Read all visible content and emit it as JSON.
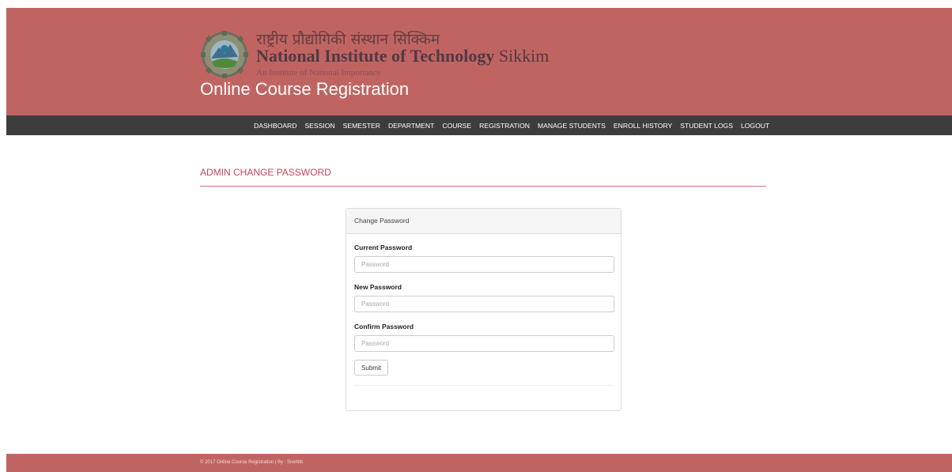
{
  "header": {
    "hindi_name": "राष्ट्रीय प्रौद्योगिकी संस्थान सिक्किम",
    "institute_name_main": "National Institute of Technology",
    "institute_name_place": "Sikkim",
    "tagline": "An Institute of National Importance",
    "app_title": "Online Course Registration",
    "logo_icon": "nit-sikkim-emblem"
  },
  "nav": {
    "items": [
      "DASHBOARD",
      "SESSION",
      "SEMESTER",
      "DEPARTMENT",
      "COURSE",
      "REGISTRATION",
      "MANAGE STUDENTS",
      "ENROLL HISTORY",
      "STUDENT LOGS",
      "LOGOUT"
    ]
  },
  "page": {
    "heading": "ADMIN CHANGE PASSWORD"
  },
  "form": {
    "panel_title": "Change Password",
    "current_label": "Current Password",
    "current_placeholder": "Password",
    "new_label": "New Password",
    "new_placeholder": "Password",
    "confirm_label": "Confirm Password",
    "confirm_placeholder": "Password",
    "submit_label": "Submit"
  },
  "footer": {
    "text": "© 2017 Online Course Registration | By : Snehith"
  },
  "colors": {
    "header_bg": "#c06462",
    "nav_bg": "#3d3d3d",
    "accent": "#c2485a"
  }
}
